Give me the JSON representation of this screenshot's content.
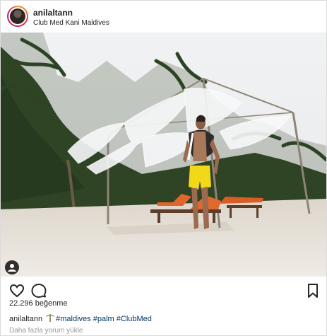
{
  "post": {
    "username": "anilaltann",
    "location": "Club Med Kani Maldives",
    "likes_text": "22.296 beğenme",
    "caption": {
      "username": "anilaltann",
      "emoji_icon": "palm-tree-icon",
      "hashtags": [
        "#maldives",
        "#palm",
        "#ClubMed"
      ]
    },
    "load_more_comments": "Daha fazla yorum yükle"
  },
  "icons": {
    "like": "heart-icon",
    "comment": "comment-icon",
    "save": "bookmark-icon",
    "tag": "person-tag-icon"
  },
  "colors": {
    "text": "#262626",
    "hashtag": "#003569",
    "muted": "#999999",
    "border": "#dbdbdb"
  }
}
